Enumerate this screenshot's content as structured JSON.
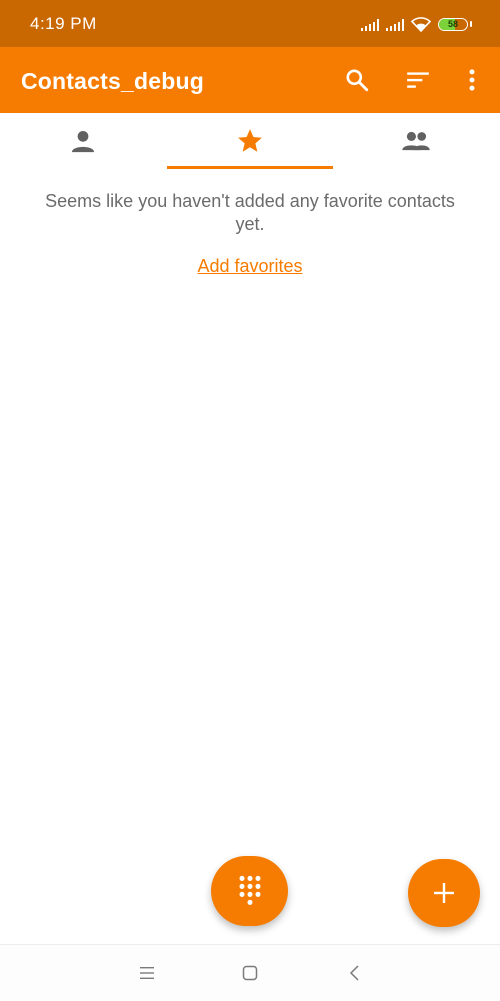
{
  "status_bar": {
    "time": "4:19 PM",
    "battery_level": "58",
    "battery_fraction": 0.58,
    "icons": [
      "signal-icon",
      "signal-icon",
      "wifi-icon",
      "battery-icon"
    ]
  },
  "app_bar": {
    "title": "Contacts_debug",
    "actions": [
      "search-icon",
      "sort-icon",
      "more-vert-icon"
    ]
  },
  "tabs": [
    {
      "name": "contacts",
      "icon": "person-icon",
      "selected": false
    },
    {
      "name": "favorites",
      "icon": "star-icon",
      "selected": true
    },
    {
      "name": "groups",
      "icon": "group-icon",
      "selected": false
    }
  ],
  "empty_state": {
    "message": "Seems like you haven't added any favorite contacts yet.",
    "link_label": "Add favorites"
  },
  "fabs": [
    "dialpad-icon",
    "plus-icon"
  ],
  "nav_bar": [
    "menu-icon",
    "home-square-icon",
    "back-chevron-icon"
  ],
  "colors": {
    "primary": "#f57c00",
    "status_bar": "#c96700",
    "battery": "#7bd23a",
    "icon_gray": "#616161",
    "text_gray": "#6b6b6b"
  }
}
